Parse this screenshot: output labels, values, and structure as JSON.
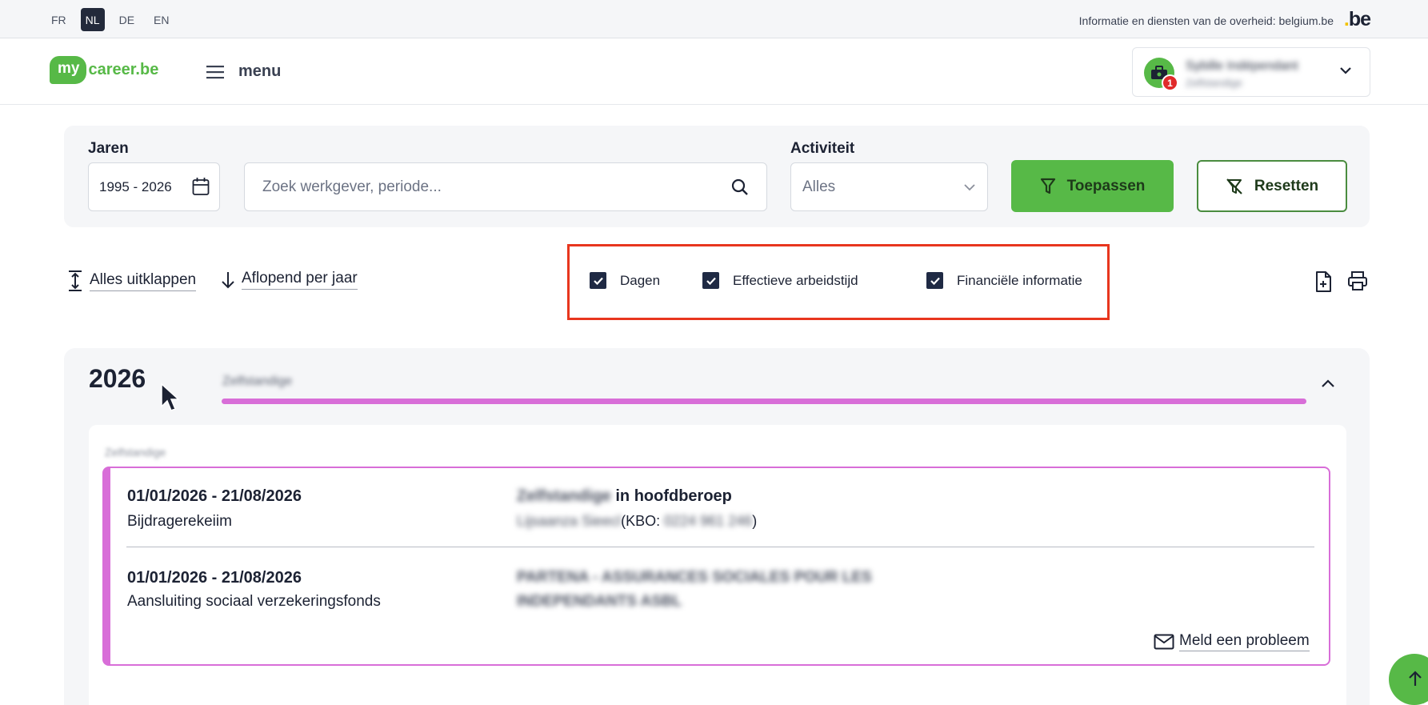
{
  "langbar": {
    "languages": [
      "FR",
      "NL",
      "DE",
      "EN"
    ],
    "active_language": "NL",
    "gov_text": "Informatie en diensten van de overheid: belgium.be",
    "be_logo": ".be"
  },
  "header": {
    "logo_my": "my",
    "logo_rest": "career.be",
    "menu_label": "menu",
    "profile": {
      "name": "Sybille Indépendant",
      "subtitle": "Zelfstandige",
      "notification_count": "1"
    }
  },
  "filters": {
    "years_label": "Jaren",
    "years_value": "1995 - 2026",
    "search_placeholder": "Zoek werkgever, periode...",
    "activity_label": "Activiteit",
    "activity_value": "Alles",
    "apply_label": "Toepassen",
    "reset_label": "Resetten"
  },
  "toolbar": {
    "expand_all": "Alles uitklappen",
    "sort": "Aflopend per jaar",
    "checkboxes": [
      {
        "label": "Dagen",
        "checked": true
      },
      {
        "label": "Effectieve arbeidstijd",
        "checked": true
      },
      {
        "label": "Financiële informatie",
        "checked": true
      }
    ]
  },
  "year_section": {
    "year": "2026",
    "category": "Zelfstandige",
    "inner_label": "Zelfstandige",
    "entries": [
      {
        "period": "01/01/2026 - 21/08/2026",
        "description": "Bijdragerekeiim",
        "status_blurred": "Zelfstandige",
        "status": "in hoofdberoep",
        "org_blurred": "Lijsaanza Sieecl",
        "kbo_label": "(KBO: ",
        "kbo_value": "0224 961 246",
        "kbo_close": ")"
      },
      {
        "period": "01/01/2026 - 21/08/2026",
        "description": "Aansluiting sociaal verzekeringsfonds",
        "fund_line1": "PARTENA - ASSURANCES SOCIALES POUR LES",
        "fund_line2": "INDEPENDANTS ASBL"
      }
    ],
    "report_label": "Meld een probleem"
  },
  "colors": {
    "brand_green": "#57b947",
    "accent_pink": "#d86ed8",
    "highlight_red": "#e8361e",
    "dark_navy": "#1f2a44"
  }
}
